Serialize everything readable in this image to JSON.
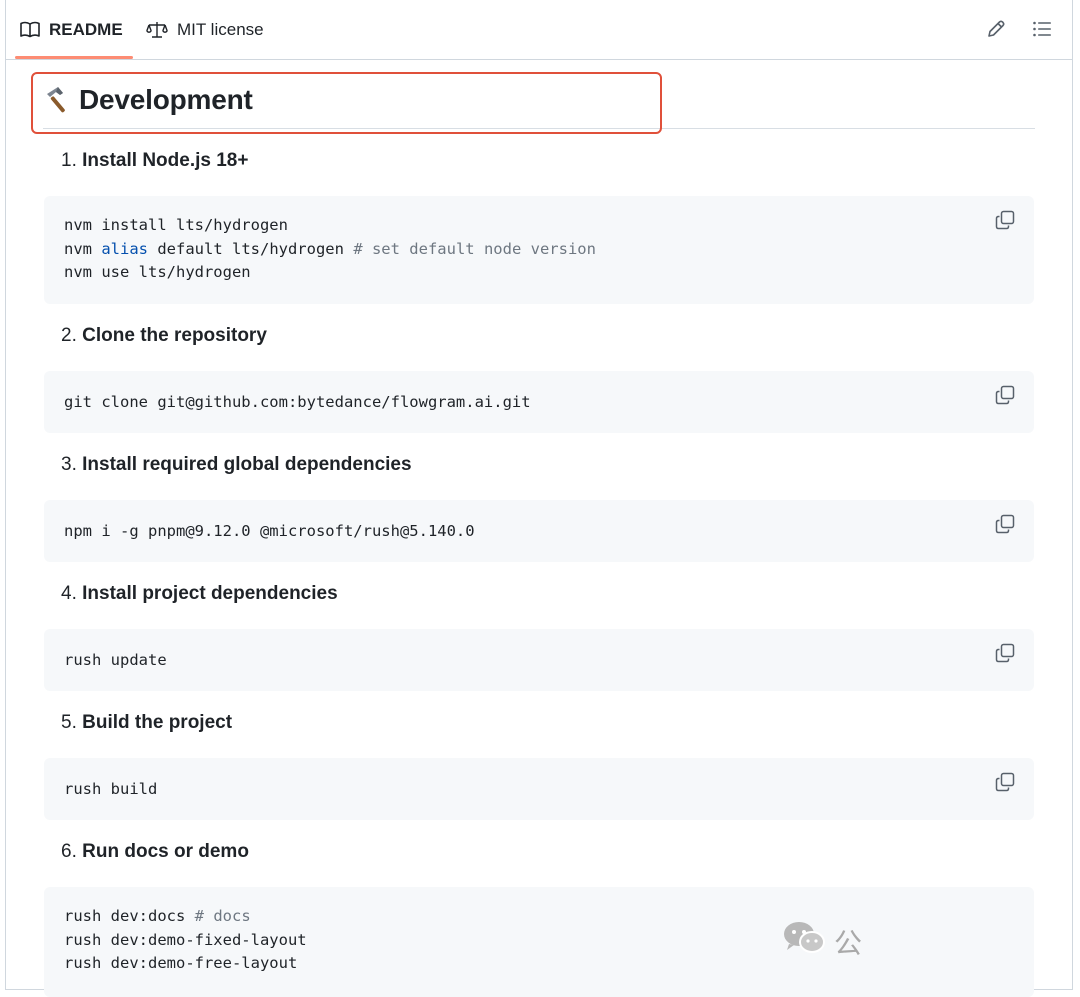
{
  "tabs": [
    {
      "label": "README",
      "icon": "book-icon",
      "active": true
    },
    {
      "label": "MIT license",
      "icon": "scale-icon",
      "active": false
    }
  ],
  "toolbar": {
    "edit_icon": "pencil-icon",
    "toc_icon": "list-icon"
  },
  "heading": {
    "emoji": "hammer-icon",
    "title": "Development"
  },
  "colors": {
    "highlight": "#e0503a",
    "tab_accent": "#fd8c73",
    "code_bg": "#f6f8fa",
    "keyword": "#0550ae",
    "comment": "#6e7781"
  },
  "steps": [
    {
      "num": "1.",
      "title": "Install Node.js 18+",
      "code": [
        [
          {
            "t": "nvm install lts/hydrogen"
          }
        ],
        [
          {
            "t": "nvm "
          },
          {
            "t": "alias",
            "k": "kw"
          },
          {
            "t": " default lts/hydrogen "
          },
          {
            "t": "# set default node version",
            "k": "cm"
          }
        ],
        [
          {
            "t": "nvm use lts/hydrogen"
          }
        ]
      ]
    },
    {
      "num": "2.",
      "title": "Clone the repository",
      "code": [
        [
          {
            "t": "git clone git@github.com:bytedance/flowgram.ai.git"
          }
        ]
      ]
    },
    {
      "num": "3.",
      "title": "Install required global dependencies",
      "code": [
        [
          {
            "t": "npm i -g pnpm@9.12.0 @microsoft/rush@5.140.0"
          }
        ]
      ]
    },
    {
      "num": "4.",
      "title": "Install project dependencies",
      "code": [
        [
          {
            "t": "rush update"
          }
        ]
      ]
    },
    {
      "num": "5.",
      "title": "Build the project",
      "code": [
        [
          {
            "t": "rush build"
          }
        ]
      ]
    },
    {
      "num": "6.",
      "title": "Run docs or demo",
      "code": [
        [
          {
            "t": "rush dev:docs "
          },
          {
            "t": "# docs",
            "k": "cm"
          }
        ],
        [
          {
            "t": "rush dev:demo-fixed-layout"
          }
        ],
        [
          {
            "t": "rush dev:demo-free-layout"
          }
        ]
      ]
    }
  ],
  "watermark": {
    "icon": "wechat-icon",
    "text": "公"
  }
}
